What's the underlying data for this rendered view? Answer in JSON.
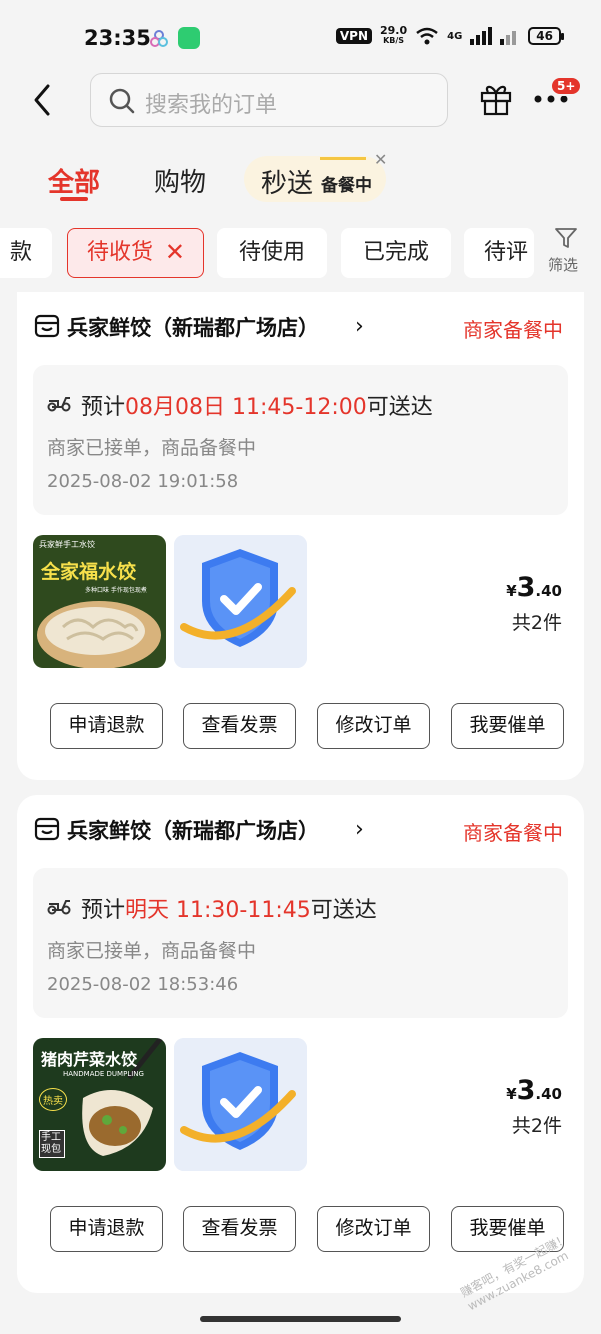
{
  "status_bar": {
    "time": "23:35",
    "vpn": "VPN",
    "speed_value": "29.0",
    "speed_unit": "KB/S",
    "network": "4G",
    "battery": "46"
  },
  "header": {
    "search_placeholder": "搜索我的订单",
    "badge": "5+"
  },
  "tabs": {
    "all": "全部",
    "shopping": "购物",
    "flash": "秒送",
    "flash_sub": "备餐中"
  },
  "filters": {
    "partial_prev": "款",
    "active": "待收货",
    "to_use": "待使用",
    "completed": "已完成",
    "to_review": "待评",
    "filter_label": "筛选"
  },
  "orders": [
    {
      "store": "兵家鲜饺（新瑞都广场店）",
      "status": "商家备餐中",
      "eta_prefix": "预计",
      "eta_highlight": "08月08日 11:45-12:00",
      "eta_suffix": "可送达",
      "sub": "商家已接单，商品备餐中",
      "time": "2025-08-02 19:01:58",
      "thumb_text": {
        "top": "兵家鲜手工水饺",
        "title": "全家福水饺",
        "tag": "多种口味 手作现包现煮"
      },
      "price_symbol": "¥",
      "price_int": "3",
      "price_dec": ".40",
      "count": "共2件",
      "buttons": [
        "申请退款",
        "查看发票",
        "修改订单",
        "我要催单"
      ]
    },
    {
      "store": "兵家鲜饺（新瑞都广场店）",
      "status": "商家备餐中",
      "eta_prefix": "预计",
      "eta_highlight": "明天 11:30-11:45",
      "eta_suffix": "可送达",
      "sub": "商家已接单，商品备餐中",
      "time": "2025-08-02 18:53:46",
      "thumb_text": {
        "title": "猪肉芹菜水饺",
        "sub": "HANDMADE DUMPLING",
        "hot": "热卖",
        "stamp": "手工现包"
      },
      "price_symbol": "¥",
      "price_int": "3",
      "price_dec": ".40",
      "count": "共2件",
      "buttons": [
        "申请退款",
        "查看发票",
        "修改订单",
        "我要催单"
      ]
    }
  ],
  "watermark": "赚客吧，有奖一起赚！www.zuanke8.com",
  "colors": {
    "accent": "#e4352b",
    "background": "#f4f4f4"
  }
}
